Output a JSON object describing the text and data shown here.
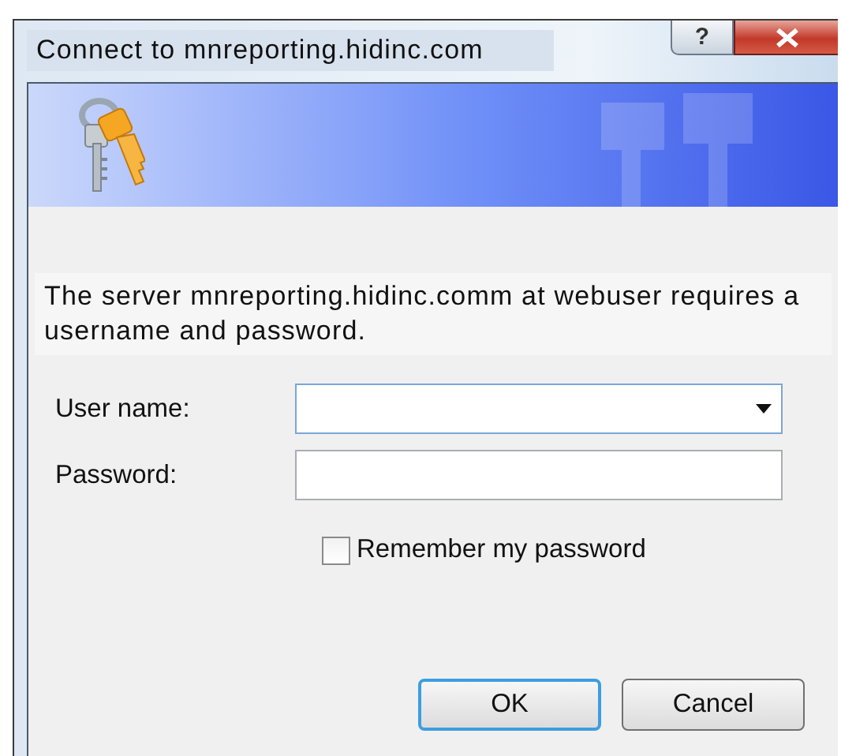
{
  "window": {
    "title": "Connect to mnreporting.hidinc.com",
    "help_button": "?"
  },
  "message": "The server mnreporting.hidinc.comm at webuser requires a username and password.",
  "fields": [
    {
      "label": "User name:",
      "kind": "combo"
    },
    {
      "label": "Password:",
      "kind": "password"
    }
  ],
  "checkbox": {
    "label": "Remember my password",
    "checked": false
  },
  "buttons": [
    {
      "label": "OK",
      "default": true
    },
    {
      "label": "Cancel",
      "default": false
    }
  ]
}
